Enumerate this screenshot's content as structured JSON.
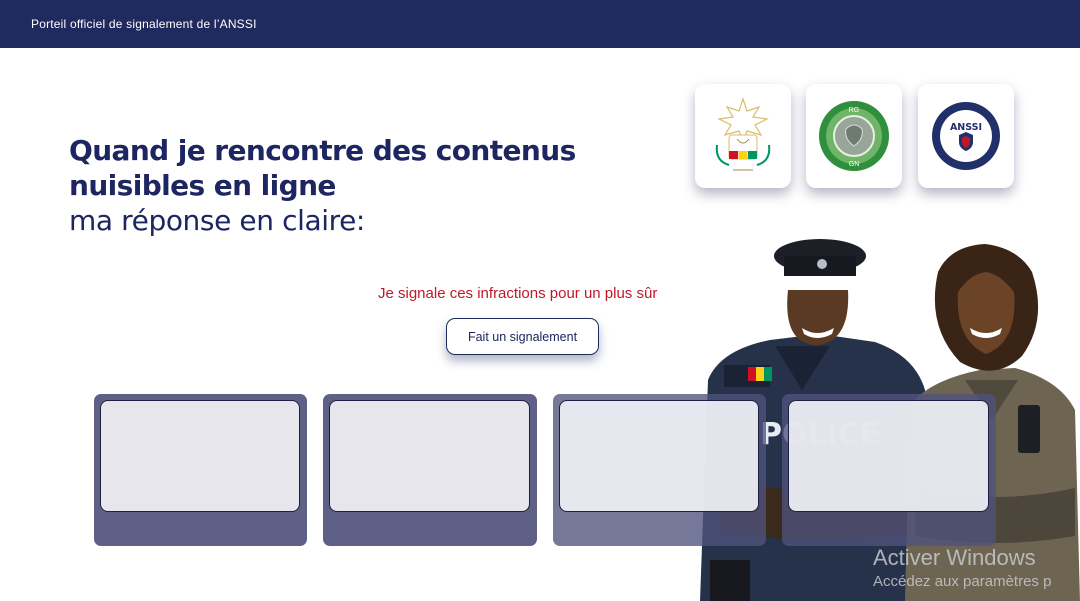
{
  "header": {
    "title": "Porteil officiel de signalement de l’ANSSI"
  },
  "hero": {
    "line1": "Quand je rencontre des contenus",
    "line2": "nuisibles en ligne",
    "line3": "ma réponse en claire:"
  },
  "tagline": "Je signale ces infractions pour un plus sûr",
  "cta": {
    "label": "Fait un signalement"
  },
  "logos": [
    {
      "name": "guinea-coat-of-arms-logo",
      "text": ""
    },
    {
      "name": "gendarmerie-logo",
      "text_top": "RG",
      "text_bottom": "GN"
    },
    {
      "name": "anssi-logo",
      "text": "ANSSI"
    }
  ],
  "illustration": {
    "badge_text": "POLICE"
  },
  "cards": [
    {
      "id": 1
    },
    {
      "id": 2
    },
    {
      "id": 3
    },
    {
      "id": 4
    }
  ],
  "watermark": {
    "title": "Activer Windows",
    "subtitle": "Accédez aux paramètres p"
  },
  "colors": {
    "navy": "#1f2a5e",
    "accent_red": "#c0182a",
    "card_frame": "#5f6085",
    "card_inner": "#e6e6ec"
  }
}
